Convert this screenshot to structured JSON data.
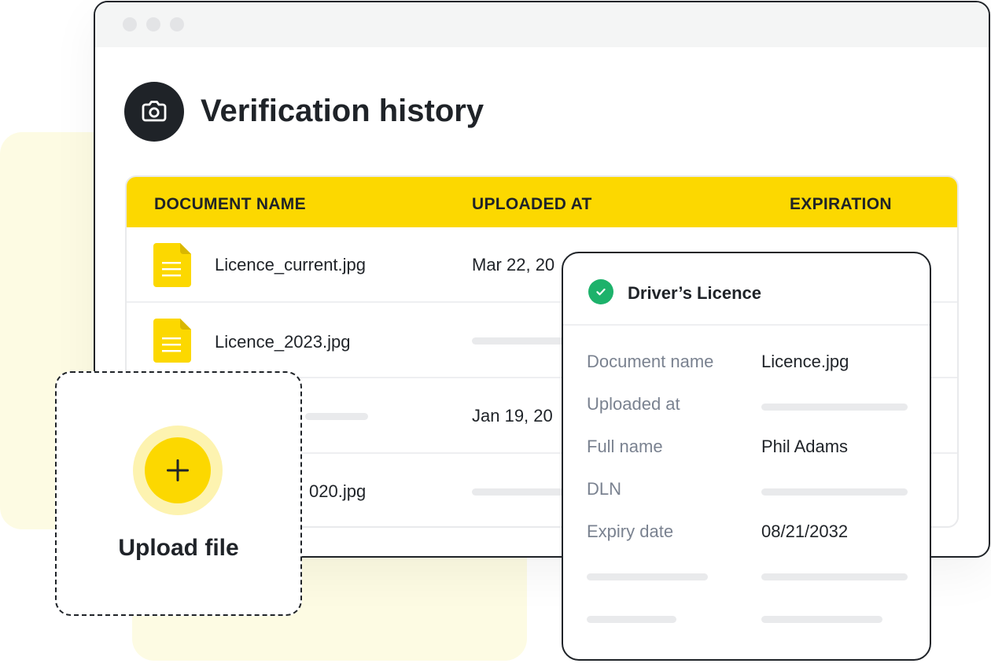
{
  "window": {
    "title": "Verification history",
    "title_icon": "camera-icon"
  },
  "table": {
    "columns": [
      "DOCUMENT NAME",
      "UPLOADED AT",
      "EXPIRATION"
    ],
    "rows": [
      {
        "name": "Licence_current.jpg",
        "uploaded": "Mar 22, 20"
      },
      {
        "name": "Licence_2023.jpg",
        "uploaded": ""
      },
      {
        "name": "",
        "uploaded": "Jan 19, 20"
      },
      {
        "name": "020.jpg",
        "uploaded": ""
      }
    ]
  },
  "upload": {
    "label": "Upload file",
    "icon": "plus-icon"
  },
  "details": {
    "title": "Driver’s Licence",
    "status_icon": "check-circle-icon",
    "fields": [
      {
        "label": "Document name",
        "value": "Licence.jpg"
      },
      {
        "label": "Uploaded at",
        "value": ""
      },
      {
        "label": "Full name",
        "value": "Phil Adams"
      },
      {
        "label": "DLN",
        "value": ""
      },
      {
        "label": "Expiry date",
        "value": "08/21/2032"
      }
    ]
  },
  "colors": {
    "accent": "#fcd800",
    "dark": "#1f2328",
    "success": "#1db26b",
    "muted_text": "#7a8290",
    "placeholder": "#e9eaec",
    "background_tint": "#fdfbe3"
  }
}
